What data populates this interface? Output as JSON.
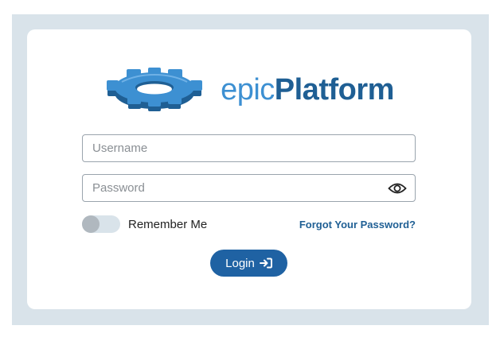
{
  "brand": {
    "name_light": "epic",
    "name_bold": "Platform",
    "gear_icon": "gear-icon",
    "colors": {
      "light": "#3d90d2",
      "bold": "#1f5f94"
    }
  },
  "form": {
    "username_placeholder": "Username",
    "password_placeholder": "Password",
    "password_toggle_icon": "eye-icon",
    "remember_label": "Remember Me",
    "remember_on": false,
    "forgot_link": "Forgot Your Password?",
    "login_label": "Login",
    "login_icon": "sign-in-icon"
  },
  "colors": {
    "backdrop": "#d9e3ea",
    "card": "#ffffff",
    "accent": "#1f62a3"
  }
}
